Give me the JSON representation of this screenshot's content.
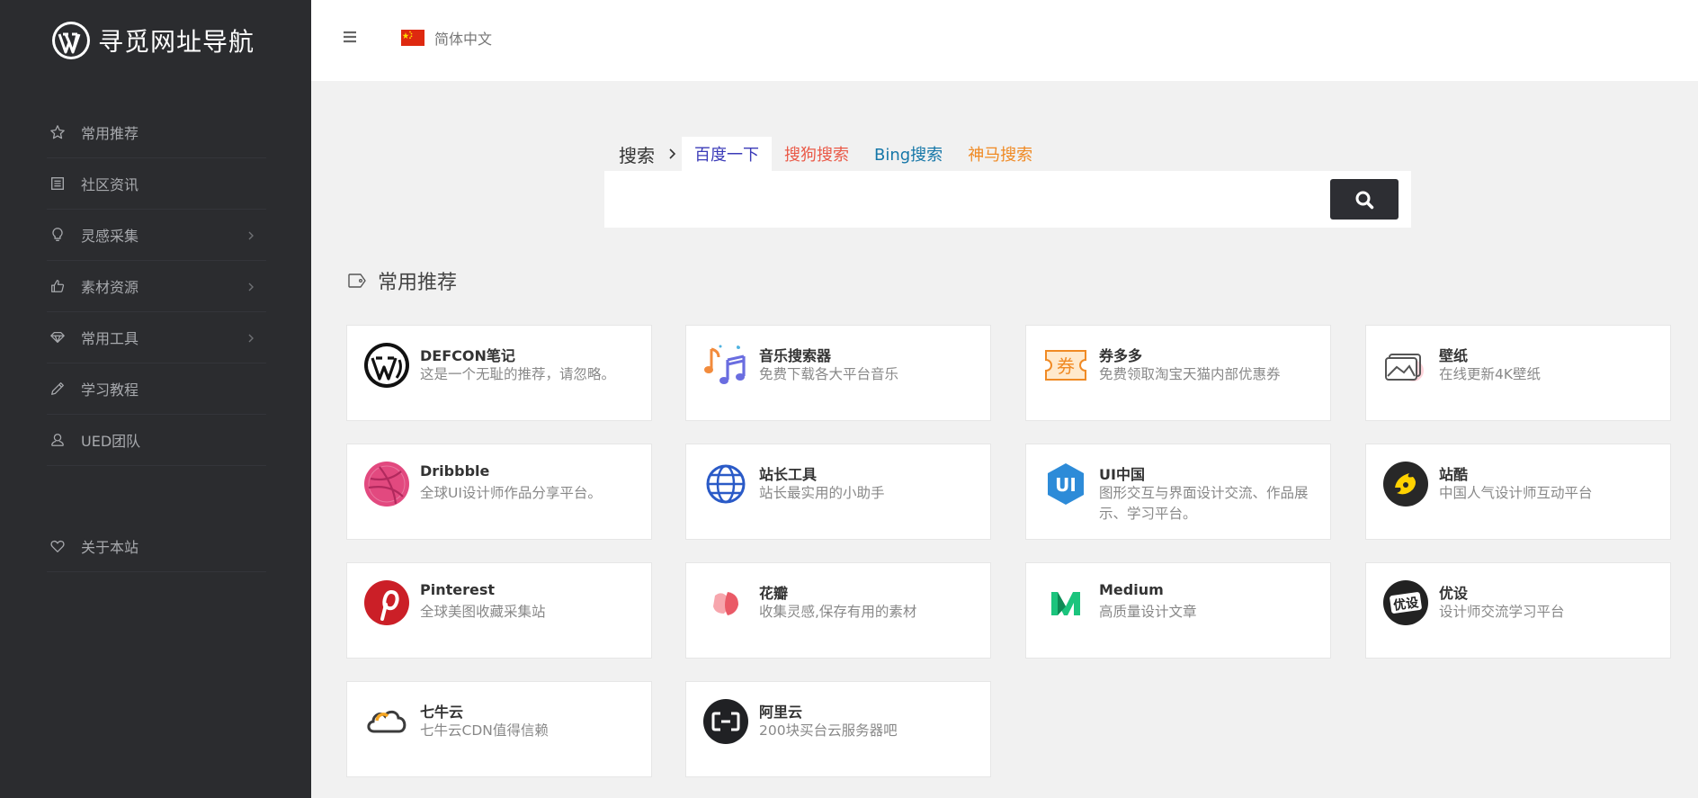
{
  "app": {
    "title": "寻觅网址导航"
  },
  "sidebar": {
    "items": [
      {
        "label": "常用推荐",
        "icon": "star-icon",
        "has_submenu": false
      },
      {
        "label": "社区资讯",
        "icon": "newspaper-icon",
        "has_submenu": false
      },
      {
        "label": "灵感采集",
        "icon": "lightbulb-icon",
        "has_submenu": true
      },
      {
        "label": "素材资源",
        "icon": "thumbs-up-icon",
        "has_submenu": true
      },
      {
        "label": "常用工具",
        "icon": "diamond-icon",
        "has_submenu": true
      },
      {
        "label": "学习教程",
        "icon": "pencil-icon",
        "has_submenu": false
      },
      {
        "label": "UED团队",
        "icon": "user-icon",
        "has_submenu": false
      }
    ],
    "about": {
      "label": "关于本站",
      "icon": "heart-icon"
    }
  },
  "topbar": {
    "language": "简体中文"
  },
  "search": {
    "title": "搜索",
    "tabs": [
      {
        "label": "百度一下",
        "color": "#3b3bb8",
        "active": true
      },
      {
        "label": "搜狗搜索",
        "color": "#ea5a48",
        "active": false
      },
      {
        "label": "Bing搜索",
        "color": "#1677a8",
        "active": false
      },
      {
        "label": "神马搜索",
        "color": "#f08a24",
        "active": false
      }
    ],
    "value": "",
    "placeholder": ""
  },
  "section": {
    "title": "常用推荐",
    "icon": "tag-icon"
  },
  "cards": [
    {
      "title": "DEFCON笔记",
      "desc": "这是一个无耻的推荐，请忽略。",
      "icon": "wordpress-icon"
    },
    {
      "title": "音乐搜索器",
      "desc": "免费下载各大平台音乐",
      "icon": "music-notes-icon"
    },
    {
      "title": "券多多",
      "desc": "免费领取淘宝天猫内部优惠券",
      "icon": "coupon-icon",
      "icon_text": "券"
    },
    {
      "title": "壁纸",
      "desc": "在线更新4K壁纸",
      "icon": "wallpaper-icon"
    },
    {
      "title": "Dribbble",
      "desc": "全球UI设计师作品分享平台。",
      "icon": "dribbble-icon"
    },
    {
      "title": "站长工具",
      "desc": "站长最实用的小助手",
      "icon": "globe-icon"
    },
    {
      "title": "UI中国",
      "desc": "图形交互与界面设计交流、作品展示、学习平台。",
      "icon": "ui-china-icon",
      "icon_text": "UI"
    },
    {
      "title": "站酷",
      "desc": "中国人气设计师互动平台",
      "icon": "zcool-icon"
    },
    {
      "title": "Pinterest",
      "desc": "全球美图收藏采集站",
      "icon": "pinterest-icon"
    },
    {
      "title": "花瓣",
      "desc": "收集灵感,保存有用的素材",
      "icon": "huaban-icon"
    },
    {
      "title": "Medium",
      "desc": "高质量设计文章",
      "icon": "medium-icon"
    },
    {
      "title": "优设",
      "desc": "设计师交流学习平台",
      "icon": "uisdc-icon",
      "icon_text": "优设"
    },
    {
      "title": "七牛云",
      "desc": "七牛云CDN值得信赖",
      "icon": "qiniu-cloud-icon"
    },
    {
      "title": "阿里云",
      "desc": "200块买台云服务器吧",
      "icon": "aliyun-icon"
    }
  ]
}
